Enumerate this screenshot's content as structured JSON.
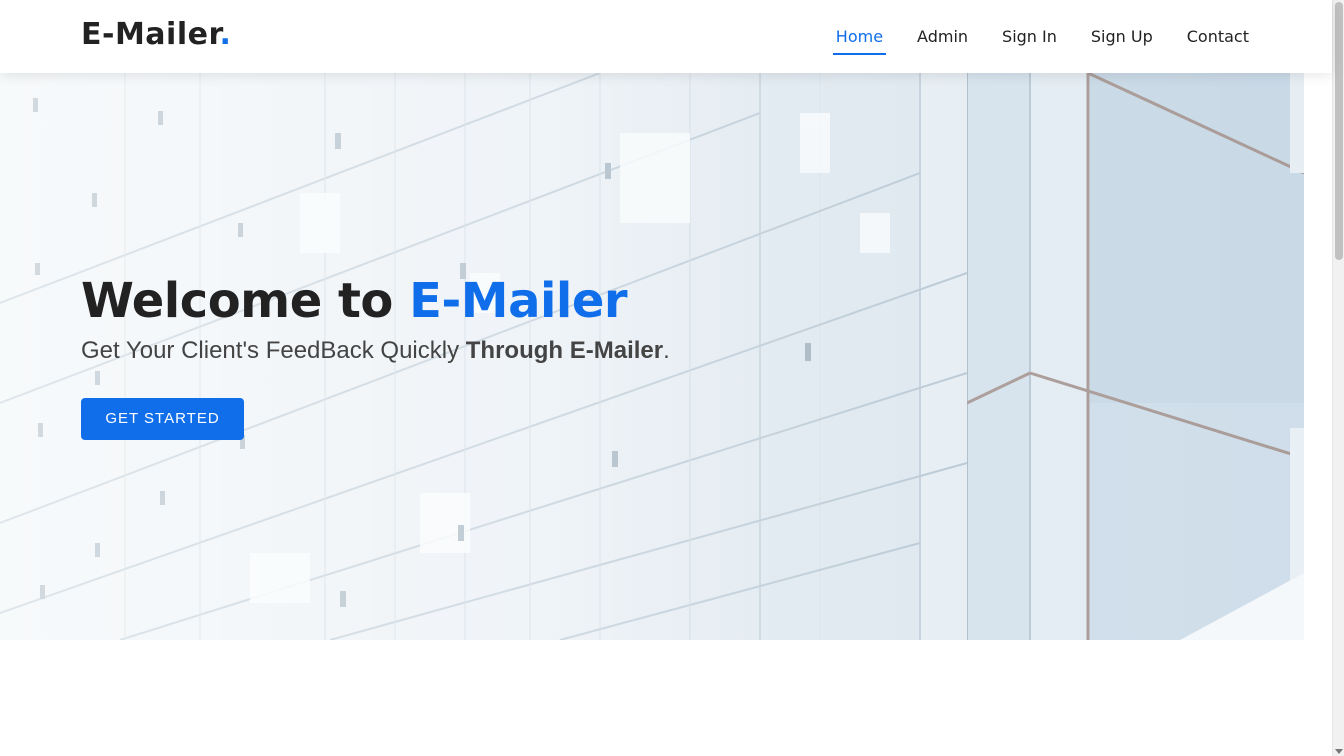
{
  "brand": {
    "name": "E-Mailer",
    "dot": ".",
    "accent_color": "#106eea"
  },
  "nav": {
    "items": [
      {
        "label": "Home",
        "active": true
      },
      {
        "label": "Admin",
        "active": false
      },
      {
        "label": "Sign In",
        "active": false
      },
      {
        "label": "Sign Up",
        "active": false
      },
      {
        "label": "Contact",
        "active": false
      }
    ]
  },
  "hero": {
    "title_prefix": "Welcome to ",
    "title_accent": "E-Mailer",
    "subtitle_prefix": "Get Your Client's FeedBack Quickly ",
    "subtitle_strong": "Through E-Mailer",
    "subtitle_suffix": ".",
    "cta_label": "GET STARTED"
  }
}
